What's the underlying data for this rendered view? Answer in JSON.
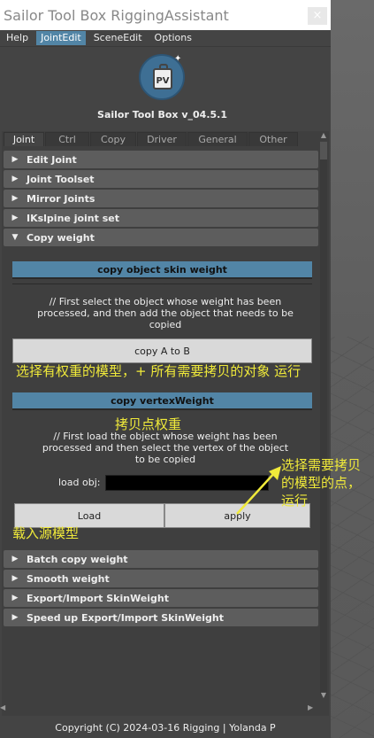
{
  "window": {
    "title": "Sailor Tool Box RiggingAssistant",
    "close_glyph": "×"
  },
  "menubar": {
    "items": [
      "Help",
      "JointEdit",
      "SceneEdit",
      "Options"
    ],
    "active": "JointEdit"
  },
  "logo": {
    "badge_text": "PV",
    "version": "Sailor Tool Box v_04.5.1"
  },
  "tabs": [
    "Joint",
    "Ctrl",
    "Copy",
    "Driver",
    "General",
    "Other"
  ],
  "active_tab": "Joint",
  "frames_top": [
    {
      "label": "Edit Joint",
      "expanded": false
    },
    {
      "label": "Joint Toolset",
      "expanded": false
    },
    {
      "label": "Mirror Joints",
      "expanded": false
    },
    {
      "label": "IKslpine joint set",
      "expanded": false
    },
    {
      "label": "Copy weight",
      "expanded": true
    }
  ],
  "copy_weight": {
    "object_section_label": "copy object skin weight",
    "object_desc": "// First select the object whose weight has been processed, and then add the object that needs to be copied",
    "copy_a_to_b": "copy A to B",
    "vertex_section_label": "copy vertexWeight",
    "vertex_desc": "// First load the object whose weight has been processed and then select the vertex of the object to be copied",
    "load_obj_label": "load obj:",
    "load_obj_value": "",
    "load_button": "Load",
    "apply_button": "apply"
  },
  "frames_bottom": [
    {
      "label": "Batch copy weight",
      "expanded": false
    },
    {
      "label": "Smooth weight",
      "expanded": false
    },
    {
      "label": "Export/Import SkinWeight",
      "expanded": false
    },
    {
      "label": "Speed up Export/Import SkinWeight",
      "expanded": false
    }
  ],
  "annotations": {
    "select_models": "选择有权重的模型，+ 所有需要拷贝的对象 运行",
    "copy_point_weight": "拷贝点权重",
    "select_points": "选择需要拷贝的模型的点，运行",
    "load_source": "载入源模型"
  },
  "footer": "Copyright (C)  2024-03-16 Rigging  | Yolanda P",
  "colors": {
    "accent_blue": "#5285a6",
    "annotation_yellow": "#f0ea3a",
    "panel_bg": "#444444"
  }
}
